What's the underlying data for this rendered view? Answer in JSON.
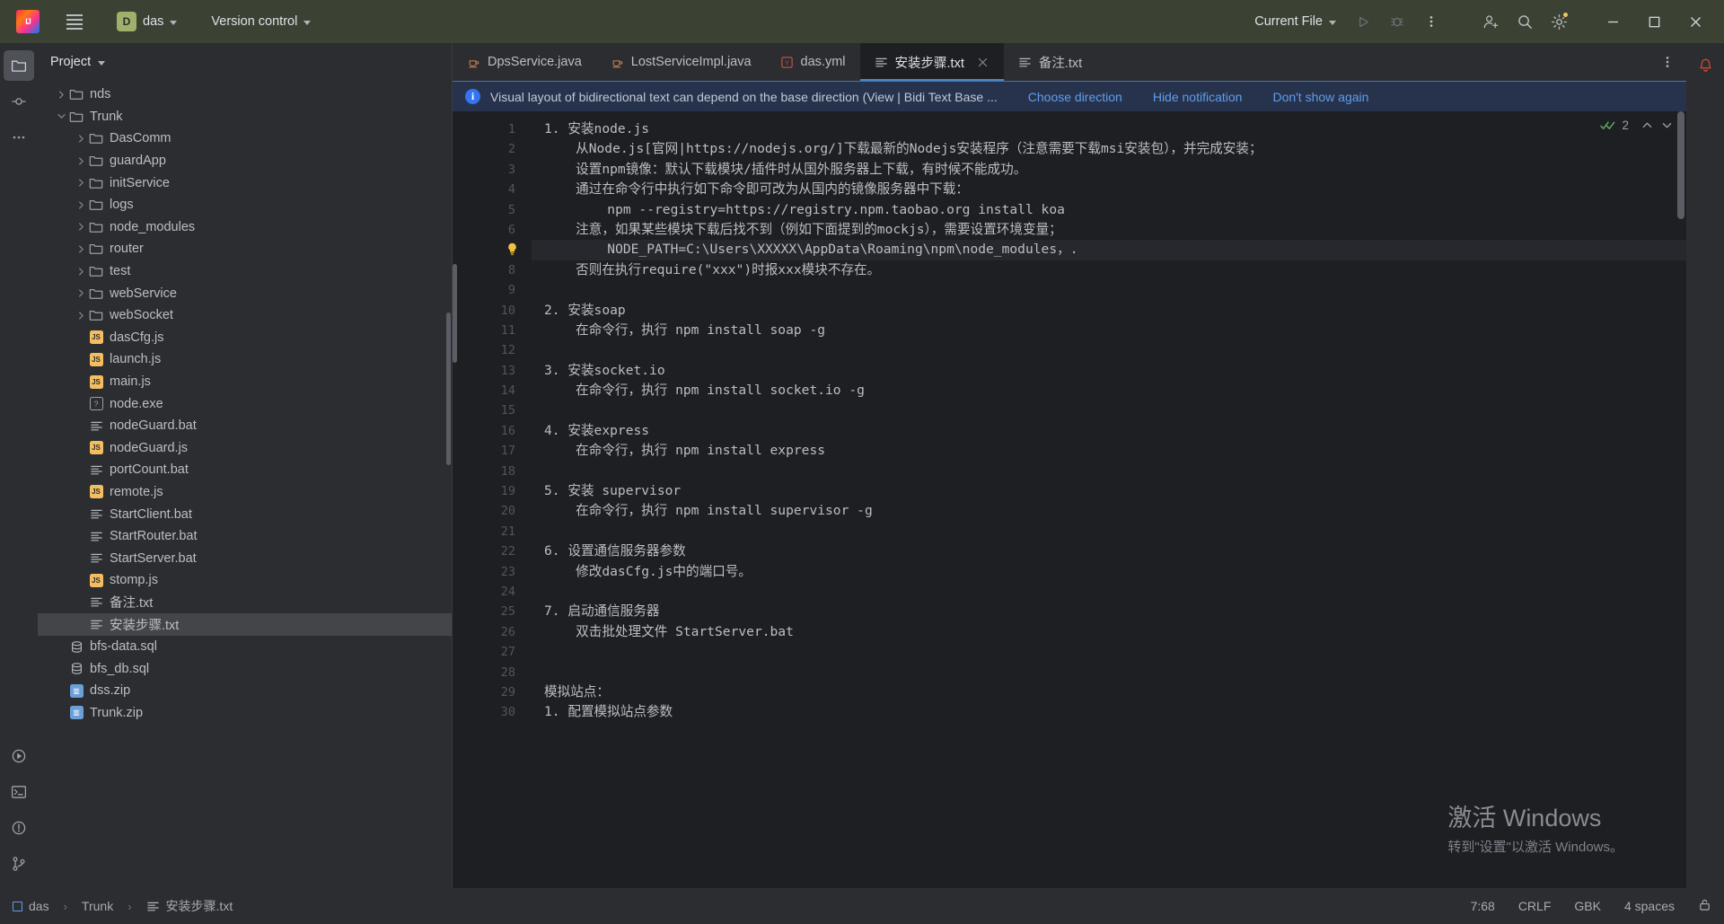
{
  "titlebar": {
    "logo_label": "IJ",
    "menu_icon": "hamburger-menu-icon",
    "project_badge": "D",
    "project_name": "das",
    "version_control": "Version control",
    "current_file": "Current File",
    "run_icon": "run-icon",
    "debug_icon": "debug-icon",
    "more_icon": "more-vertical-icon",
    "account_icon": "account-icon",
    "search_icon": "search-icon",
    "settings_icon": "settings-gear-icon",
    "minimize": "minimize-icon",
    "maximize": "maximize-icon",
    "close": "close-icon"
  },
  "left_stripe": [
    {
      "name": "project-tool-window",
      "icon": "folder-icon",
      "active": true
    },
    {
      "name": "commit-tool-window",
      "icon": "commit-icon",
      "active": false
    },
    {
      "name": "more-tool-windows",
      "icon": "ellipsis-icon",
      "active": false
    }
  ],
  "left_stripe_bottom": [
    {
      "name": "run-tool-window",
      "icon": "play-icon"
    },
    {
      "name": "terminal-tool-window",
      "icon": "terminal-icon"
    },
    {
      "name": "problems-tool-window",
      "icon": "warning-icon"
    },
    {
      "name": "version-control-tool-window",
      "icon": "branch-icon"
    }
  ],
  "project": {
    "title": "Project",
    "tree": [
      {
        "label": "nds",
        "type": "folder",
        "indent": 1,
        "arrow": "collapsed"
      },
      {
        "label": "Trunk",
        "type": "folder",
        "indent": 1,
        "arrow": "expanded"
      },
      {
        "label": "DasComm",
        "type": "folder",
        "indent": 2,
        "arrow": "collapsed"
      },
      {
        "label": "guardApp",
        "type": "folder",
        "indent": 2,
        "arrow": "collapsed"
      },
      {
        "label": "initService",
        "type": "folder",
        "indent": 2,
        "arrow": "collapsed"
      },
      {
        "label": "logs",
        "type": "folder",
        "indent": 2,
        "arrow": "collapsed"
      },
      {
        "label": "node_modules",
        "type": "folder",
        "indent": 2,
        "arrow": "collapsed"
      },
      {
        "label": "router",
        "type": "folder",
        "indent": 2,
        "arrow": "collapsed"
      },
      {
        "label": "test",
        "type": "folder",
        "indent": 2,
        "arrow": "collapsed"
      },
      {
        "label": "webService",
        "type": "folder",
        "indent": 2,
        "arrow": "collapsed"
      },
      {
        "label": "webSocket",
        "type": "folder",
        "indent": 2,
        "arrow": "collapsed"
      },
      {
        "label": "dasCfg.js",
        "type": "js",
        "indent": 2,
        "arrow": "none"
      },
      {
        "label": "launch.js",
        "type": "js",
        "indent": 2,
        "arrow": "none"
      },
      {
        "label": "main.js",
        "type": "js",
        "indent": 2,
        "arrow": "none"
      },
      {
        "label": "node.exe",
        "type": "unknown",
        "indent": 2,
        "arrow": "none"
      },
      {
        "label": "nodeGuard.bat",
        "type": "text",
        "indent": 2,
        "arrow": "none"
      },
      {
        "label": "nodeGuard.js",
        "type": "js",
        "indent": 2,
        "arrow": "none"
      },
      {
        "label": "portCount.bat",
        "type": "text",
        "indent": 2,
        "arrow": "none"
      },
      {
        "label": "remote.js",
        "type": "js",
        "indent": 2,
        "arrow": "none"
      },
      {
        "label": "StartClient.bat",
        "type": "text",
        "indent": 2,
        "arrow": "none"
      },
      {
        "label": "StartRouter.bat",
        "type": "text",
        "indent": 2,
        "arrow": "none"
      },
      {
        "label": "StartServer.bat",
        "type": "text",
        "indent": 2,
        "arrow": "none"
      },
      {
        "label": "stomp.js",
        "type": "js",
        "indent": 2,
        "arrow": "none"
      },
      {
        "label": "备注.txt",
        "type": "text",
        "indent": 2,
        "arrow": "none"
      },
      {
        "label": "安装步骤.txt",
        "type": "text",
        "indent": 2,
        "arrow": "none",
        "selected": true
      },
      {
        "label": "bfs-data.sql",
        "type": "sql",
        "indent": 1,
        "arrow": "none"
      },
      {
        "label": "bfs_db.sql",
        "type": "sql",
        "indent": 1,
        "arrow": "none"
      },
      {
        "label": "dss.zip",
        "type": "zip",
        "indent": 1,
        "arrow": "none"
      },
      {
        "label": "Trunk.zip",
        "type": "zip",
        "indent": 1,
        "arrow": "none"
      }
    ]
  },
  "tabs": [
    {
      "label": "DpsService.java",
      "icon": "java-icon",
      "active": false,
      "closeable": false
    },
    {
      "label": "LostServiceImpl.java",
      "icon": "java-icon",
      "active": false,
      "closeable": false
    },
    {
      "label": "das.yml",
      "icon": "yaml-icon",
      "active": false,
      "closeable": false
    },
    {
      "label": "安装步骤.txt",
      "icon": "text-file-icon",
      "active": true,
      "closeable": true
    },
    {
      "label": "备注.txt",
      "icon": "text-file-icon",
      "active": false,
      "closeable": false
    }
  ],
  "notification": {
    "icon": "info-icon",
    "message": "Visual layout of bidirectional text can depend on the base direction (View | Bidi Text Base ...",
    "actions": [
      "Choose direction",
      "Hide notification",
      "Don't show again"
    ]
  },
  "inspection_widget": {
    "count": "2",
    "ok_icon": "inspection-ok-icon",
    "up_icon": "chevron-up-icon",
    "down_icon": "chevron-down-icon"
  },
  "editor": {
    "lines": [
      {
        "n": "1",
        "text": "1. 安装node.js"
      },
      {
        "n": "2",
        "text": "    从Node.js[官网|https://nodejs.org/]下载最新的Nodejs安装程序（注意需要下载msi安装包），并完成安装；"
      },
      {
        "n": "3",
        "text": "    设置npm镜像：默认下载模块/插件时从国外服务器上下载，有时候不能成功。"
      },
      {
        "n": "4",
        "text": "    通过在命令行中执行如下命令即可改为从国内的镜像服务器中下载："
      },
      {
        "n": "5",
        "text": "        npm --registry=https://registry.npm.taobao.org install koa"
      },
      {
        "n": "6",
        "text": "    注意，如果某些模块下载后找不到（例如下面提到的mockjs），需要设置环境变量；"
      },
      {
        "n": "7",
        "text": "        NODE_PATH=C:\\Users\\XXXXX\\AppData\\Roaming\\npm\\node_modules，.",
        "highlight": true,
        "bulb": true
      },
      {
        "n": "8",
        "text": "    否则在执行require(\"xxx\")时报xxx模块不存在。"
      },
      {
        "n": "9",
        "text": ""
      },
      {
        "n": "10",
        "text": "2. 安装soap"
      },
      {
        "n": "11",
        "text": "    在命令行，执行 npm install soap -g"
      },
      {
        "n": "12",
        "text": ""
      },
      {
        "n": "13",
        "text": "3. 安装socket.io"
      },
      {
        "n": "14",
        "text": "    在命令行，执行 npm install socket.io -g"
      },
      {
        "n": "15",
        "text": ""
      },
      {
        "n": "16",
        "text": "4. 安装express"
      },
      {
        "n": "17",
        "text": "    在命令行，执行 npm install express"
      },
      {
        "n": "18",
        "text": ""
      },
      {
        "n": "19",
        "text": "5. 安装 supervisor"
      },
      {
        "n": "20",
        "text": "    在命令行，执行 npm install supervisor -g"
      },
      {
        "n": "21",
        "text": ""
      },
      {
        "n": "22",
        "text": "6. 设置通信服务器参数"
      },
      {
        "n": "23",
        "text": "    修改dasCfg.js中的端口号。"
      },
      {
        "n": "24",
        "text": ""
      },
      {
        "n": "25",
        "text": "7. 启动通信服务器"
      },
      {
        "n": "26",
        "text": "    双击批处理文件 StartServer.bat"
      },
      {
        "n": "27",
        "text": ""
      },
      {
        "n": "28",
        "text": ""
      },
      {
        "n": "29",
        "text": "模拟站点："
      },
      {
        "n": "30",
        "text": "1. 配置模拟站点参数"
      }
    ]
  },
  "watermark": {
    "line1": "激活 Windows",
    "line2": "转到\"设置\"以激活 Windows。"
  },
  "statusbar": {
    "breadcrumb": [
      {
        "label": "das",
        "icon": "module-icon"
      },
      {
        "label": "Trunk",
        "icon": "none"
      },
      {
        "label": "安装步骤.txt",
        "icon": "text-file-icon"
      }
    ],
    "caret": "7:68",
    "line_sep": "CRLF",
    "encoding": "GBK",
    "indent": "4 spaces",
    "lock_icon": "unlocked-icon"
  },
  "right_stripe": {
    "notifications_icon": "bell-icon"
  }
}
